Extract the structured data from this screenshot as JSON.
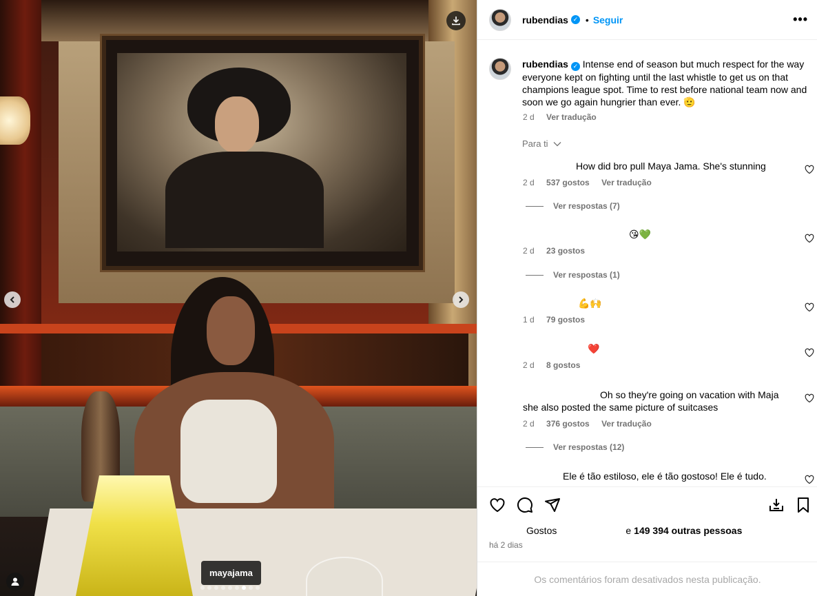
{
  "post": {
    "tag_username": "mayajama",
    "carousel_dot_count": 9,
    "carousel_active_index": 6
  },
  "header": {
    "username": "rubendias",
    "separator": "•",
    "follow_label": "Seguir",
    "more_label": "•••"
  },
  "caption": {
    "username": "rubendias",
    "text": "Intense end of season but much respect for the way everyone kept on fighting until the last whistle to get us on that champions league spot. Time to rest before national team now and soon we go again hungrier than ever. 🫡",
    "time": "2 d",
    "translate": "Ver tradução"
  },
  "sort_label": "Para ti",
  "comments": [
    {
      "text": "How did bro pull Maya Jama. She's stunning",
      "time": "2 d",
      "likes": "537 gostos",
      "translate": "Ver tradução",
      "replies": "Ver respostas (7)"
    },
    {
      "text": "😘💚",
      "time": "2 d",
      "likes": "23 gostos",
      "translate": "",
      "replies": "Ver respostas (1)"
    },
    {
      "text": "💪🙌",
      "time": "1 d",
      "likes": "79 gostos",
      "translate": "",
      "replies": ""
    },
    {
      "text": "❤️",
      "time": "2 d",
      "likes": "8 gostos",
      "translate": "",
      "replies": ""
    },
    {
      "text": "Oh so they're going on vacation with Maja she also posted the same picture of suitcases",
      "time": "2 d",
      "likes": "376 gostos",
      "translate": "Ver tradução",
      "replies": "Ver respostas (12)"
    },
    {
      "text": "Ele é tão estiloso, ele é tão gostoso! Ele é tudo.",
      "time": "",
      "likes": "",
      "translate": "",
      "replies": ""
    }
  ],
  "likes": {
    "prefix": "Gostos",
    "suffix_e": "e",
    "count_text": "149 394 outras pessoas"
  },
  "timestamp": "há 2 dias",
  "comments_closed": "Os comentários foram desativados nesta publicação.",
  "colors": {
    "accent": "#0095f6",
    "muted": "#737373"
  }
}
